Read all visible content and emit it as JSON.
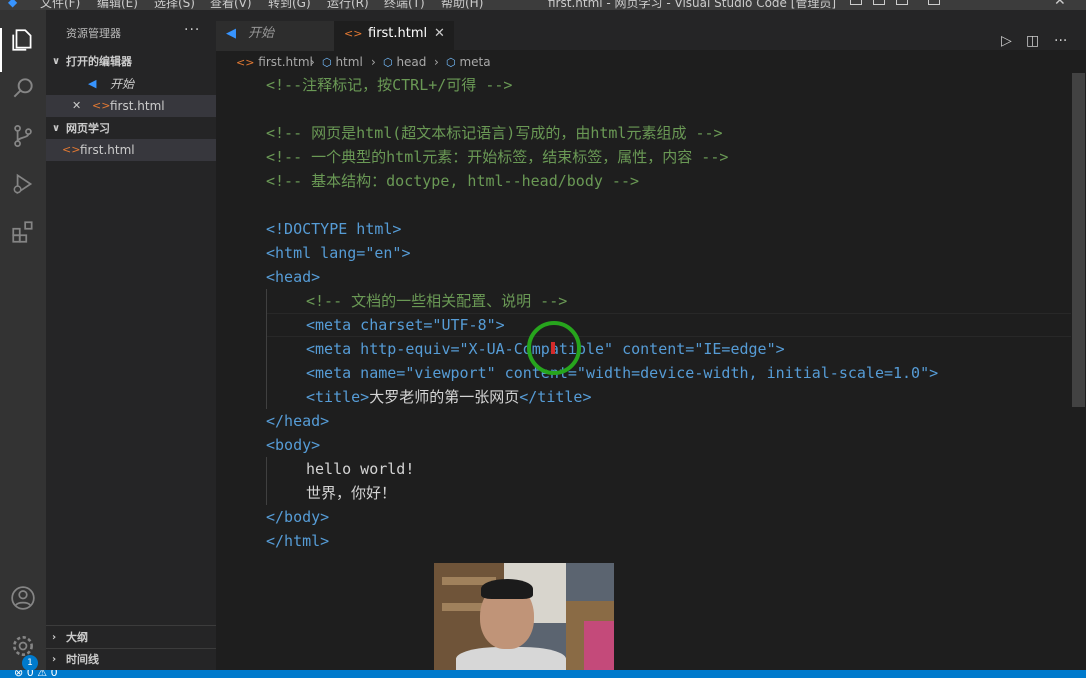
{
  "window": {
    "title": "first.html - 网页学习 - Visual Studio Code [管理员]",
    "menu": [
      "文件(F)",
      "编辑(E)",
      "选择(S)",
      "查看(V)",
      "转到(G)",
      "运行(R)",
      "终端(T)",
      "帮助(H)"
    ]
  },
  "activity_bar": {
    "items": [
      "files-icon",
      "search-icon",
      "source-control-icon",
      "run-debug-icon",
      "extensions-icon"
    ],
    "bottom": [
      "account-icon",
      "settings-icon"
    ],
    "settings_badge": "1"
  },
  "explorer": {
    "title": "资源管理器",
    "more": "···",
    "open_editors": {
      "label": "打开的编辑器",
      "items": [
        {
          "name": "开始",
          "icon": "vscode-icon"
        },
        {
          "name": "first.html",
          "icon": "html-icon",
          "close": "✕"
        }
      ]
    },
    "workspace": {
      "label": "网页学习",
      "files": [
        {
          "name": "first.html",
          "icon": "html-icon"
        }
      ]
    },
    "outline": "大纲",
    "timeline": "时间线"
  },
  "tabs": [
    {
      "label": "开始",
      "icon": "vscode-icon"
    },
    {
      "label": "first.html",
      "icon": "html-icon",
      "close": "✕"
    }
  ],
  "editor_actions": [
    "run-icon",
    "split-editor-icon",
    "more-actions-icon"
  ],
  "breadcrumb": [
    "first.html",
    "html",
    "head",
    "meta"
  ],
  "code": {
    "l1": "<!--注释标记，按CTRL+/可得 -->",
    "l3": "<!-- 网页是html(超文本标记语言)写成的，由html元素组成 -->",
    "l4": "<!-- 一个典型的html元素：开始标签，结束标签，属性，内容 -->",
    "l5": "<!-- 基本结构：doctype, html--head/body -->",
    "l7": "<!DOCTYPE html>",
    "l8": "<html lang=\"en\">",
    "l9": "<head>",
    "l10": "<!-- 文档的一些相关配置、说明 -->",
    "l11": "<meta charset=\"UTF-8\">",
    "l12": "<meta http-equiv=\"X-UA-Compatible\" content=\"IE=edge\">",
    "l13": "<meta name=\"viewport\" content=\"width=device-width, initial-scale=1.0\">",
    "l14_open": "<title>",
    "l14_text": "大罗老师的第一张网页",
    "l14_close": "</title>",
    "l15": "</head>",
    "l16": "<body>",
    "l17": "hello world!",
    "l18": "世界，你好！",
    "l19": "</body>",
    "l20": "</html>"
  },
  "colors": {
    "activity_bar": "#333333",
    "sidebar": "#252526",
    "editor": "#1e1e1e",
    "status_bar": "#007acc",
    "comment": "#6a9955",
    "tag": "#569cd6",
    "attribute": "#9cdcfe",
    "string": "#ce9178",
    "cursor_ring": "#27a51d"
  }
}
